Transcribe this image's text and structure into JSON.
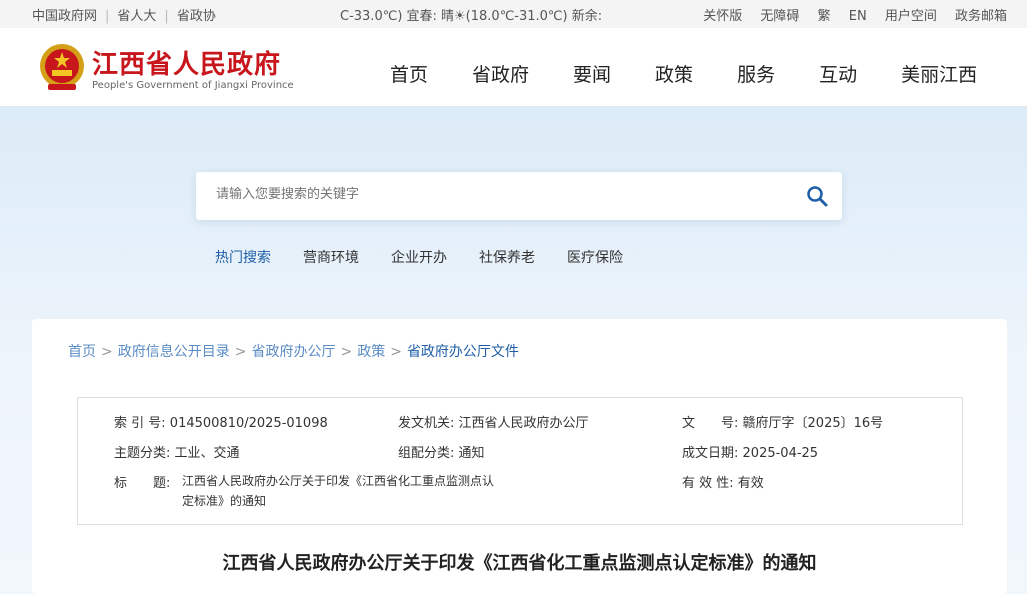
{
  "topbar": {
    "links_left": [
      "中国政府网",
      "省人大",
      "省政协"
    ],
    "weather": "C-33.0℃)    宜春: 晴☀(18.0℃-31.0℃)    新余:",
    "links_right": [
      "关怀版",
      "无障碍",
      "繁",
      "EN",
      "用户空间",
      "政务邮箱"
    ]
  },
  "header": {
    "title": "江西省人民政府",
    "subtitle": "People's Government of Jiangxi Province",
    "nav": [
      "首页",
      "省政府",
      "要闻",
      "政策",
      "服务",
      "互动",
      "美丽江西"
    ]
  },
  "search": {
    "placeholder": "请输入您要搜索的关键字",
    "hot_label": "热门搜索",
    "hot_terms": [
      "营商环境",
      "企业开办",
      "社保养老",
      "医疗保险"
    ]
  },
  "breadcrumb": [
    "首页",
    "政府信息公开目录",
    "省政府办公厅",
    "政策",
    "省政府办公厅文件"
  ],
  "meta": {
    "index_label": "索 引 号:",
    "index_value": "014500810/2025-01098",
    "issuer_label": "发文机关:",
    "issuer_value": "江西省人民政府办公厅",
    "docno_label": "文　　号:",
    "docno_value": "赣府厅字〔2025〕16号",
    "topic_label": "主题分类:",
    "topic_value": "工业、交通",
    "genre_label": "组配分类:",
    "genre_value": "通知",
    "date_label": "成文日期:",
    "date_value": "2025-04-25",
    "title_label": "标　　题:",
    "title_value_line1": "江西省人民政府办公厅关于印发《江西省化工重点监测点认",
    "title_value_line2": "定标准》的通知",
    "validity_label": "有 效 性:",
    "validity_value": "有效"
  },
  "document_title": "江西省人民政府办公厅关于印发《江西省化工重点监测点认定标准》的通知",
  "colors": {
    "brand_red": "#c8161d",
    "link_blue": "#1f5fa8"
  }
}
